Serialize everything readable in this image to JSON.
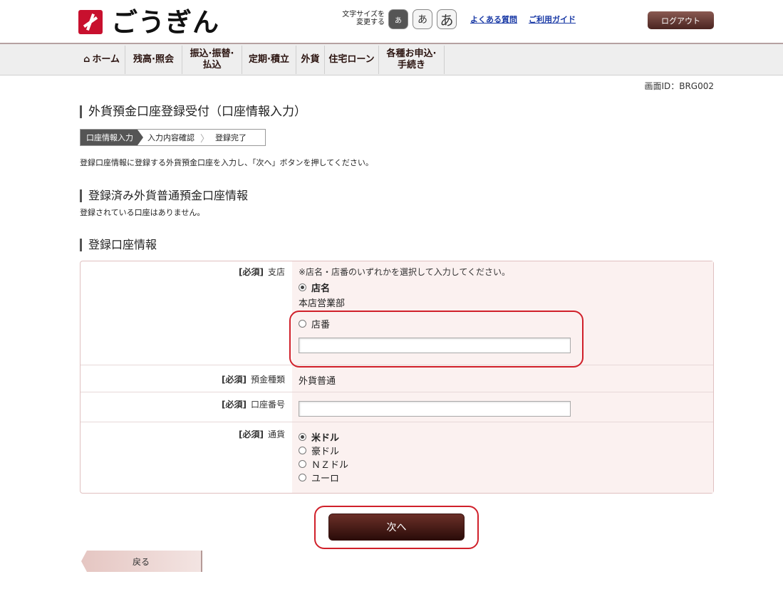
{
  "header": {
    "logo_text": "ごうぎん",
    "fontsize_label": "文字サイズを 変更する",
    "fontsize_small": "あ",
    "fontsize_medium": "あ",
    "fontsize_large": "あ",
    "faq_link": "よくある質問",
    "guide_link": "ご利用ガイド",
    "logout": "ログアウト"
  },
  "nav": {
    "home": "ホーム",
    "balance": "残高·照会",
    "transfer_line1": "振込·振替·",
    "transfer_line2": "払込",
    "deposit": "定期·積立",
    "foreign": "外貨",
    "housing": "住宅ローン",
    "apply_line1": "各種お申込·",
    "apply_line2": "手続き"
  },
  "screen_id": "画面ID：BRG002",
  "page_title": "外貨預金口座登録受付（口座情報入力）",
  "steps": [
    "口座情報入力",
    "入力内容確認",
    "登録完了"
  ],
  "instruction": "登録口座情報に登録する外貨預金口座を入力し、「次へ」ボタンを押してください。",
  "registered": {
    "heading": "登録済み外貨普通預金口座情報",
    "message": "登録されている口座はありません。"
  },
  "account_info": {
    "heading": "登録口座情報",
    "required": "[必須]",
    "branch_label": "支店",
    "branch_note": "※店名・店番のいずれかを選択して入力してください。",
    "branch_name_option": "店名",
    "branch_name_value": "本店営業部",
    "branch_number_option": "店番",
    "branch_number_value": "",
    "deposit_type_label": "預金種類",
    "deposit_type_value": "外貨普通",
    "account_number_label": "口座番号",
    "account_number_value": "",
    "currency_label": "通貨",
    "currencies": [
      "米ドル",
      "豪ドル",
      "ＮＺドル",
      "ユーロ"
    ],
    "selected_currency": "米ドル"
  },
  "buttons": {
    "next": "次へ",
    "back": "戻る"
  },
  "colors": {
    "brand_red": "#c8102e",
    "button_dark": "#4a1a15",
    "highlight_red": "#d0202a",
    "form_value_bg": "#fbf1f0"
  }
}
